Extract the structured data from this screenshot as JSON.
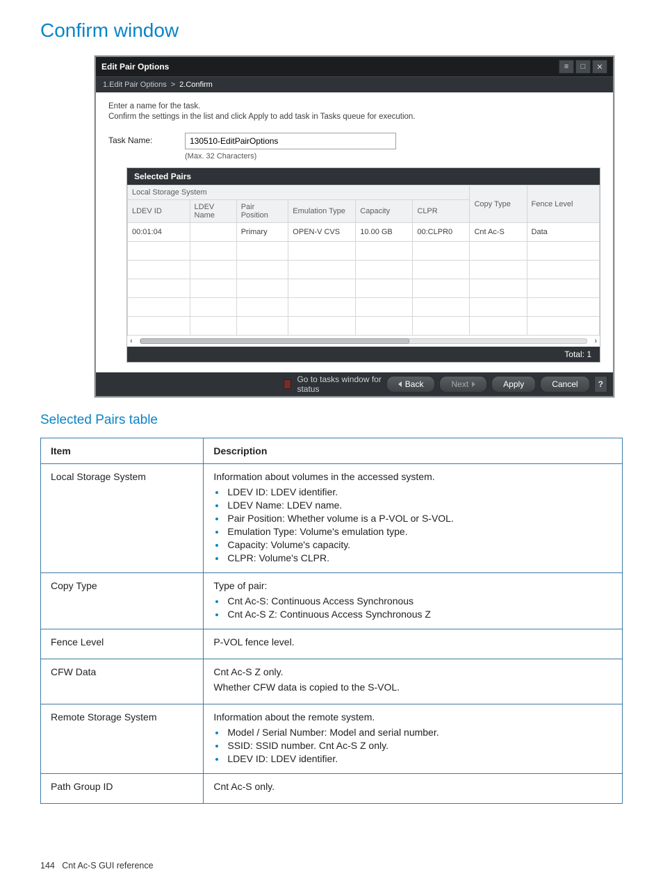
{
  "doc": {
    "heading": "Confirm window",
    "subheading": "Selected Pairs table",
    "page_number": "144",
    "footer_section": "Cnt Ac-S GUI reference"
  },
  "dialog": {
    "title": "Edit Pair Options",
    "wizard": {
      "step1_label": "1.Edit Pair Options",
      "sep": ">",
      "step2_label": "2.Confirm"
    },
    "intro_line1": "Enter a name for the task.",
    "intro_line2": "Confirm the settings in the list and click Apply to add task in Tasks queue for execution.",
    "task_label": "Task Name:",
    "task_value": "130510-EditPairOptions",
    "task_hint": "(Max. 32 Characters)",
    "selpanel_title": "Selected Pairs",
    "group_lss": "Local Storage System",
    "cols": {
      "ldev_id": "LDEV ID",
      "ldev_name": "LDEV Name",
      "pair_pos": "Pair Position",
      "emu_type": "Emulation Type",
      "capacity": "Capacity",
      "clpr": "CLPR",
      "copy_type": "Copy Type",
      "fence_level": "Fence Level"
    },
    "rows": [
      {
        "ldev_id": "00:01:04",
        "ldev_name": "",
        "pair_pos": "Primary",
        "emu_type": "OPEN-V CVS",
        "capacity": "10.00 GB",
        "clpr": "00:CLPR0",
        "copy_type": "Cnt Ac-S",
        "fence_level": "Data"
      }
    ],
    "total_label": "Total:  1",
    "footer": {
      "go_label": "Go to tasks window for status",
      "back": "Back",
      "next": "Next",
      "apply": "Apply",
      "cancel": "Cancel"
    }
  },
  "table": {
    "headers": {
      "item": "Item",
      "desc": "Description"
    },
    "lss": {
      "item": "Local Storage System",
      "lead": "Information about volumes in the accessed system.",
      "b1": "LDEV ID: LDEV identifier.",
      "b2": "LDEV Name: LDEV name.",
      "b3": "Pair Position: Whether volume is a P-VOL or S-VOL.",
      "b4": "Emulation Type: Volume's emulation type.",
      "b5": "Capacity: Volume's capacity.",
      "b6": "CLPR: Volume's CLPR."
    },
    "copy": {
      "item": "Copy Type",
      "lead": "Type of pair:",
      "b1": "Cnt Ac-S: Continuous Access Synchronous",
      "b2": "Cnt Ac-S Z: Continuous Access Synchronous Z"
    },
    "fence": {
      "item": "Fence Level",
      "desc": "P-VOL fence level."
    },
    "cfw": {
      "item": "CFW Data",
      "l1": "Cnt Ac-S Z only.",
      "l2": "Whether CFW data is copied to the S-VOL."
    },
    "rss": {
      "item": "Remote Storage System",
      "lead": "Information about the remote system.",
      "b1": "Model / Serial Number: Model and serial number.",
      "b2": "SSID: SSID number. Cnt Ac-S Z only.",
      "b3": "LDEV ID: LDEV identifier."
    },
    "pgid": {
      "item": "Path Group ID",
      "desc": "Cnt Ac-S only."
    }
  }
}
